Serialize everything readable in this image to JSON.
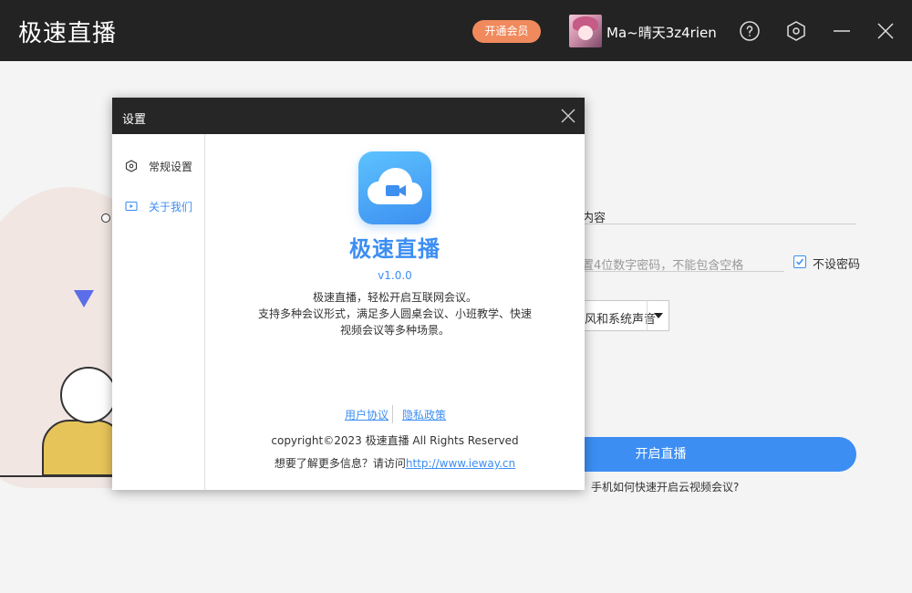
{
  "app": {
    "title": "极速直播",
    "vip_button": "开通会员",
    "username": "Ma~晴天3z4rien"
  },
  "titlebar_icons": [
    "help-icon",
    "settings-icon",
    "minimize-icon",
    "close-icon"
  ],
  "main": {
    "topic_value": "内容",
    "password_placeholder": "置4位数字密码，不能包含空格",
    "no_password_label": "不设密码",
    "no_password_checked": true,
    "audio_select_value": "风和系统声音",
    "start_button": "开启直播",
    "help_link": "手机如何快速开启云视频会议?"
  },
  "dialog": {
    "title": "设置",
    "sidebar": [
      {
        "label": "常规设置",
        "icon": "hexagon-gear-icon",
        "active": false
      },
      {
        "label": "关于我们",
        "icon": "video-icon",
        "active": true
      }
    ],
    "about": {
      "title": "极速直播",
      "version": "v1.0.0",
      "desc_lines": [
        "极速直播，轻松开启互联网会议。",
        "支持多种会议形式，满足多人圆桌会议、小班教学、快速",
        "视频会议等多种场景。"
      ],
      "user_agreement": "用户协议",
      "privacy_policy": "隐私政策",
      "copyright": "copyright©2023 极速直播 All Rights Reserved",
      "more_info_prefix": "想要了解更多信息？请访问",
      "website": "http://www.ieway.cn"
    }
  },
  "colors": {
    "titlebar": "#232323",
    "accent": "#3c8ef3",
    "vip": "#f08a5d"
  }
}
